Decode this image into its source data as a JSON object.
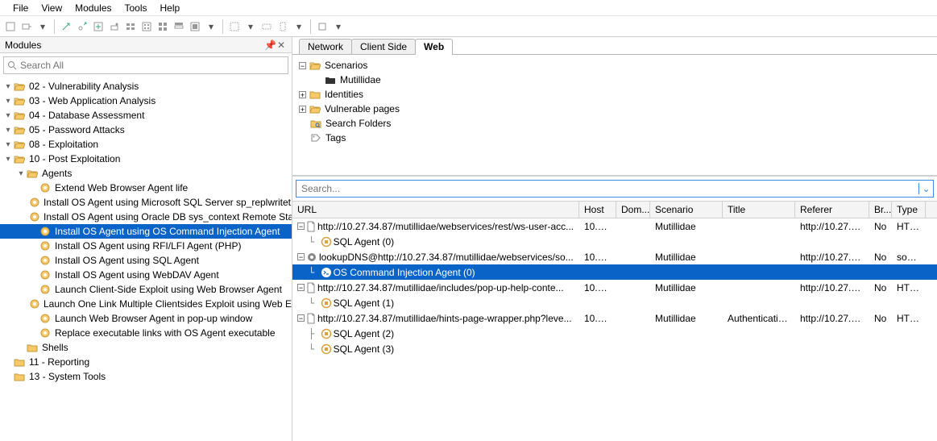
{
  "menu": {
    "items": [
      "File",
      "View",
      "Modules",
      "Tools",
      "Help"
    ]
  },
  "left_panel": {
    "title": "Modules",
    "search_placeholder": "Search All",
    "tree": [
      {
        "d": 0,
        "exp": "▾",
        "icon": "folder-open",
        "label": "02 - Vulnerability Analysis"
      },
      {
        "d": 0,
        "exp": "▾",
        "icon": "folder-open",
        "label": "03 - Web Application Analysis"
      },
      {
        "d": 0,
        "exp": "▾",
        "icon": "folder-open",
        "label": "04 - Database Assessment"
      },
      {
        "d": 0,
        "exp": "▾",
        "icon": "folder-open",
        "label": "05 - Password Attacks"
      },
      {
        "d": 0,
        "exp": "▾",
        "icon": "folder-open",
        "label": "08 - Exploitation"
      },
      {
        "d": 0,
        "exp": "▾",
        "icon": "folder-open",
        "label": "10 - Post Exploitation"
      },
      {
        "d": 1,
        "exp": "▾",
        "icon": "folder-open",
        "label": "Agents"
      },
      {
        "d": 2,
        "exp": "",
        "icon": "gear",
        "label": "Extend Web Browser Agent life"
      },
      {
        "d": 2,
        "exp": "",
        "icon": "gear",
        "label": "Install OS Agent using Microsoft SQL Server sp_replwritet"
      },
      {
        "d": 2,
        "exp": "",
        "icon": "gear",
        "label": "Install OS Agent using Oracle DB sys_context Remote Sta"
      },
      {
        "d": 2,
        "exp": "",
        "icon": "gear",
        "label": "Install OS Agent using OS Command Injection Agent",
        "selected": true
      },
      {
        "d": 2,
        "exp": "",
        "icon": "gear",
        "label": "Install OS Agent using RFI/LFI Agent (PHP)"
      },
      {
        "d": 2,
        "exp": "",
        "icon": "gear",
        "label": "Install OS Agent using SQL Agent"
      },
      {
        "d": 2,
        "exp": "",
        "icon": "gear",
        "label": "Install OS Agent using WebDAV Agent"
      },
      {
        "d": 2,
        "exp": "",
        "icon": "gear",
        "label": "Launch Client-Side Exploit using Web Browser Agent"
      },
      {
        "d": 2,
        "exp": "",
        "icon": "gear",
        "label": "Launch One Link Multiple Clientsides Exploit using Web E"
      },
      {
        "d": 2,
        "exp": "",
        "icon": "gear",
        "label": "Launch Web Browser Agent in pop-up window"
      },
      {
        "d": 2,
        "exp": "",
        "icon": "gear",
        "label": "Replace executable links with OS Agent executable"
      },
      {
        "d": 1,
        "exp": "",
        "icon": "folder-closed",
        "label": "Shells"
      },
      {
        "d": 0,
        "exp": "",
        "icon": "folder-closed",
        "label": "11 - Reporting"
      },
      {
        "d": 0,
        "exp": "",
        "icon": "folder-closed",
        "label": "13 - System Tools"
      }
    ]
  },
  "right_panel": {
    "tabs": [
      {
        "label": "Network",
        "active": false
      },
      {
        "label": "Client Side",
        "active": false
      },
      {
        "label": "Web",
        "active": true
      }
    ],
    "scenario_tree": [
      {
        "d": 0,
        "exp": "−",
        "icon": "folder-open",
        "label": "Scenarios"
      },
      {
        "d": 1,
        "exp": "",
        "icon": "folder-dark",
        "label": "Mutillidae"
      },
      {
        "d": 0,
        "exp": "+",
        "icon": "folder-closed",
        "label": "Identities"
      },
      {
        "d": 0,
        "exp": "+",
        "icon": "folder-open",
        "label": "Vulnerable pages"
      },
      {
        "d": 0,
        "exp": "",
        "icon": "search-folder",
        "label": "Search Folders"
      },
      {
        "d": 0,
        "exp": "",
        "icon": "tag",
        "label": "Tags"
      }
    ],
    "table_search_placeholder": "Search...",
    "columns": [
      "URL",
      "Host",
      "Dom...",
      "Scenario",
      "Title",
      "Referer",
      "Br...",
      "Type"
    ],
    "rows": [
      {
        "url": "http://10.27.34.87/mutillidae/webservices/rest/ws-user-acc...",
        "host": "10.27....",
        "dom": "",
        "scenario": "Mutillidae",
        "title": "",
        "referer": "http://10.27.34...",
        "br": "No",
        "type": "HTML",
        "children": [
          {
            "icon": "sql",
            "label": "SQL Agent (0)"
          }
        ]
      },
      {
        "url": "lookupDNS@http://10.27.34.87/mutillidae/webservices/so...",
        "url_icon": "gear-row",
        "host": "10.27....",
        "dom": "",
        "scenario": "Mutillidae",
        "title": "",
        "referer": "http://10.27.34...",
        "br": "No",
        "type": "soap...",
        "children": [
          {
            "icon": "cmd",
            "label": "OS Command Injection Agent (0)",
            "selected": true
          }
        ]
      },
      {
        "url": "http://10.27.34.87/mutillidae/includes/pop-up-help-conte...",
        "host": "10.27....",
        "dom": "",
        "scenario": "Mutillidae",
        "title": "",
        "referer": "http://10.27.34...",
        "br": "No",
        "type": "HTML",
        "children": [
          {
            "icon": "sql",
            "label": "SQL Agent (1)"
          }
        ]
      },
      {
        "url": "http://10.27.34.87/mutillidae/hints-page-wrapper.php?leve...",
        "host": "10.27....",
        "dom": "",
        "scenario": "Mutillidae",
        "title": "Authenticatio...",
        "referer": "http://10.27.34...",
        "br": "No",
        "type": "HTML",
        "children": [
          {
            "icon": "sql",
            "label": "SQL Agent (2)"
          },
          {
            "icon": "sql",
            "label": "SQL Agent (3)"
          }
        ]
      }
    ]
  }
}
